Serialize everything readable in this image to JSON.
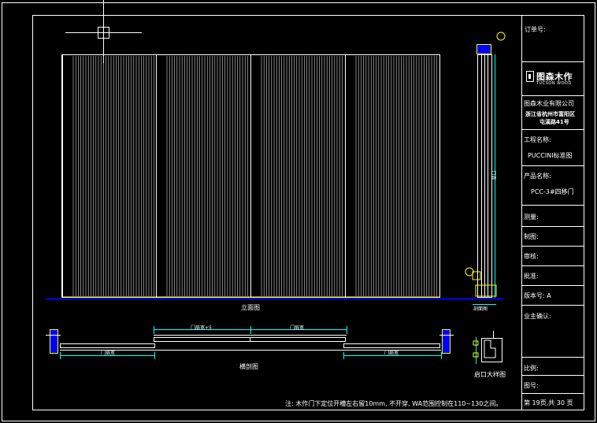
{
  "title_block": {
    "order_no_label": "订单号:",
    "brand_name": "图森木作",
    "brand_sub": "TUCSON WOOD",
    "company": "图森木业有限公司",
    "address_line1": "浙江省杭州市富阳区",
    "address_line2": "屯溪路41号",
    "project_label": "工程名称:",
    "project_value": "PUCCINI标准图",
    "product_label": "产品名称:",
    "product_value": "PCC-3#四移门",
    "measure_label": "测量:",
    "draw_label": "制图:",
    "review_label": "审核:",
    "approve_label": "批准:",
    "version_label": "版本号: A",
    "owner_label": "业主确认:",
    "scale_label": "比例:",
    "drawing_no_label": "图号:",
    "page_label": "第 19页,共 30 页"
  },
  "drawing": {
    "elevation_caption": "立面图",
    "section_caption": "横剖图",
    "detail_caption": "启口大样图",
    "side_caption": "剖面图",
    "dim_top_left": "门扇宽+5",
    "dim_top_right": "门扇宽",
    "dim_bottom_left": "门扇宽",
    "dim_bottom_right": "门扇宽",
    "side_dim": "门高",
    "note": "注: 木作门下定位开槽左右留10mm, 不开穿, WA范围控制在110~130之间。"
  },
  "colors": {
    "background": "#000000",
    "line_white": "#ffffff",
    "dim_cyan": "#00ffff",
    "accent_yellow": "#ffff00",
    "ground_blue": "#0000ff"
  }
}
